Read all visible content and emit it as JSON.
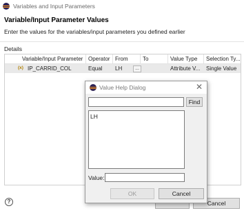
{
  "window": {
    "title": "Variables and Input Parameters"
  },
  "header": {
    "title": "Variable/Input Parameter Values",
    "description": "Enter the values for the variables/input parameters you defined earlier"
  },
  "details": {
    "label": "Details",
    "columns": [
      "Variable/Input Parameter",
      "Operator",
      "From",
      "To",
      "Value Type",
      "Selection Ty..."
    ],
    "rows": [
      {
        "icon_text": "(x)",
        "icon": "variable-icon",
        "name": "IP_CARRID_COL",
        "operator": "Equal",
        "from": "LH",
        "from_button": "...",
        "to": "",
        "value_type": "Attribute V...",
        "selection_type": "Single Value"
      }
    ]
  },
  "footer": {
    "help_icon": "?",
    "cancel_label": "Cancel"
  },
  "dialog": {
    "title": "Value Help Dialog",
    "close_glyph": "✕",
    "search_value": "",
    "find_label": "Find",
    "results": [
      "LH"
    ],
    "value_label": "Value:",
    "value": "",
    "ok_label": "OK",
    "cancel_label": "Cancel"
  },
  "colors": {
    "selected_row": "#e9e9e9",
    "dialog_bg": "#f0f0f0",
    "disabled_text": "#9a9a9a"
  }
}
